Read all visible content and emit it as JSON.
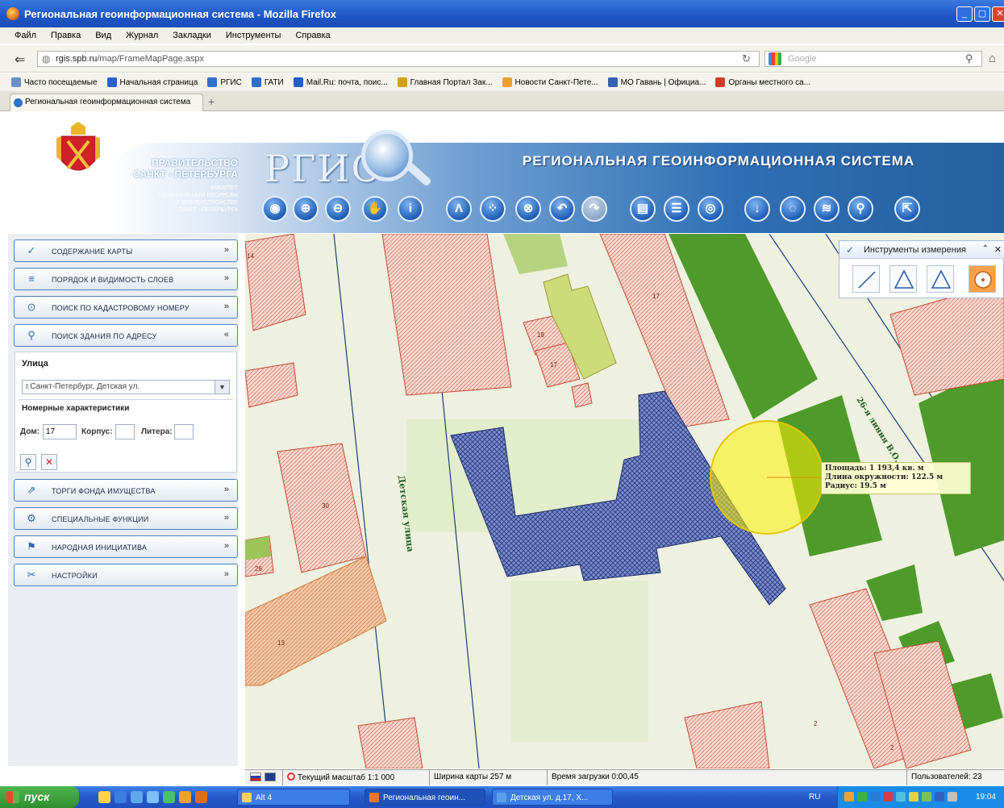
{
  "window": {
    "title": "Региональная геоинформационная система - Mozilla Firefox",
    "min": "_",
    "max": "▢",
    "close": "✕"
  },
  "menu": [
    "Файл",
    "Правка",
    "Вид",
    "Журнал",
    "Закладки",
    "Инструменты",
    "Справка"
  ],
  "nav": {
    "url_domain": "rgis.spb.ru",
    "url_path": "/map/FrameMapPage.aspx",
    "search_placeholder": "Google"
  },
  "bookmarks": [
    {
      "label": "Часто посещаемые",
      "color": "#6b8fc7"
    },
    {
      "label": "Начальная страница",
      "color": "#2a62c6"
    },
    {
      "label": "РГИС",
      "color": "#3470c8"
    },
    {
      "label": "ГАТИ",
      "color": "#2c6fd0"
    },
    {
      "label": "Mail.Ru: почта, поис...",
      "color": "#1d5ec8"
    },
    {
      "label": "Главная Портал Зак...",
      "color": "#d4a017"
    },
    {
      "label": "Новости Санкт-Пете...",
      "color": "#f0a030"
    },
    {
      "label": "МО Гавань | Официа...",
      "color": "#3a5fb0"
    },
    {
      "label": "Органы местного са...",
      "color": "#c8402a"
    }
  ],
  "tab": {
    "label": "Региональная геоинформационная система",
    "new": "+"
  },
  "header": {
    "gov_line1": "ПРАВИТЕЛЬСТВО",
    "gov_line2": "САНКТ - ПЕТЕРБУРГА",
    "gov_sub": [
      "КОМИТЕТ",
      "ПО ЗЕМЕЛЬНЫМ РЕСУРСАМ",
      "И ЗЕМЛЕУСТРОЙСТВУ",
      "САНКТ - ПЕТЕРБУРГА"
    ],
    "logo": "РГИС",
    "system_title": "РЕГИОНАЛЬНАЯ  ГЕОИНФОРМАЦИОННАЯ  СИСТЕМА"
  },
  "toolbar": [
    {
      "name": "globe-icon",
      "glyph": "◉"
    },
    {
      "name": "zoom-in-icon",
      "glyph": "⊕"
    },
    {
      "name": "zoom-out-icon",
      "glyph": "⊖"
    },
    {
      "name": "pan-hand-icon",
      "glyph": "✋"
    },
    {
      "name": "info-icon",
      "glyph": "i"
    },
    {
      "name": "compass-icon",
      "glyph": "Λ"
    },
    {
      "name": "select-icon",
      "glyph": "⁘"
    },
    {
      "name": "clear-icon",
      "glyph": "⊗"
    },
    {
      "name": "undo-icon",
      "glyph": "↶"
    },
    {
      "name": "redo-icon",
      "glyph": "↷",
      "disabled": true
    },
    {
      "name": "print-icon",
      "glyph": "▤"
    },
    {
      "name": "list-icon",
      "glyph": "☰"
    },
    {
      "name": "world-icon",
      "glyph": "◎"
    },
    {
      "name": "download-icon",
      "glyph": "↓"
    },
    {
      "name": "comment-icon",
      "glyph": "◌"
    },
    {
      "name": "rss-icon",
      "glyph": "≋"
    },
    {
      "name": "pin-icon",
      "glyph": "⚲"
    },
    {
      "name": "export-icon",
      "glyph": "⇱"
    }
  ],
  "panel": {
    "sections": [
      {
        "label": "Содержание карты",
        "icon": "✓",
        "chev": "»"
      },
      {
        "label": "Порядок и видимость слоев",
        "icon": "≡",
        "chev": "»"
      },
      {
        "label": "Поиск по кадастровому номеру",
        "icon": "⊙",
        "chev": "»"
      },
      {
        "label": "Поиск здания по адресу",
        "icon": "⚲",
        "chev": "«"
      }
    ],
    "address": {
      "street_label": "Улица",
      "street_value": "г.Санкт-Петербург, Детская ул.",
      "numbers_label": "Номерные характеристики",
      "house_label": "Дом:",
      "house_value": "17",
      "korpus_label": "Корпус:",
      "korpus_value": "",
      "litera_label": "Литера:",
      "litera_value": "",
      "search_btn": "⚲",
      "clear_btn": "✕"
    },
    "sections_bottom": [
      {
        "label": "Торги фонда имущества",
        "icon": "⇗",
        "chev": "»"
      },
      {
        "label": "Специальные функции",
        "icon": "⚙",
        "chev": "»"
      },
      {
        "label": "Народная инициатива",
        "icon": "⚑",
        "chev": "»"
      },
      {
        "label": "Настройки",
        "icon": "✂",
        "chev": "»"
      }
    ]
  },
  "map": {
    "street_label_1": "Детская улица",
    "street_label_2": "26-я линия В.О.",
    "house_numbers": [
      "18",
      "17",
      "17",
      "26",
      "30",
      "13",
      "2",
      "14",
      "2"
    ]
  },
  "measure": {
    "title": "Инструменты измерения",
    "collapse": "⌃",
    "close": "✕"
  },
  "popup": {
    "area": "Площадь: 1 193,4 кв. м",
    "circumference": "Длина окружности: 122.5 м",
    "radius": "Радиус: 19.5 м"
  },
  "status": {
    "scale": "Текущий масштаб 1:1 000",
    "width": "Ширина карты 257 м",
    "load": "Время загрузки 0:00,45",
    "users": "Пользователей: 23"
  },
  "taskbar": {
    "start": "пуск",
    "tasks": [
      "Alt 4",
      "Региональная геоин...",
      "Детская ул. д.17, Х..."
    ],
    "lang": "RU",
    "clock": "19:04"
  }
}
